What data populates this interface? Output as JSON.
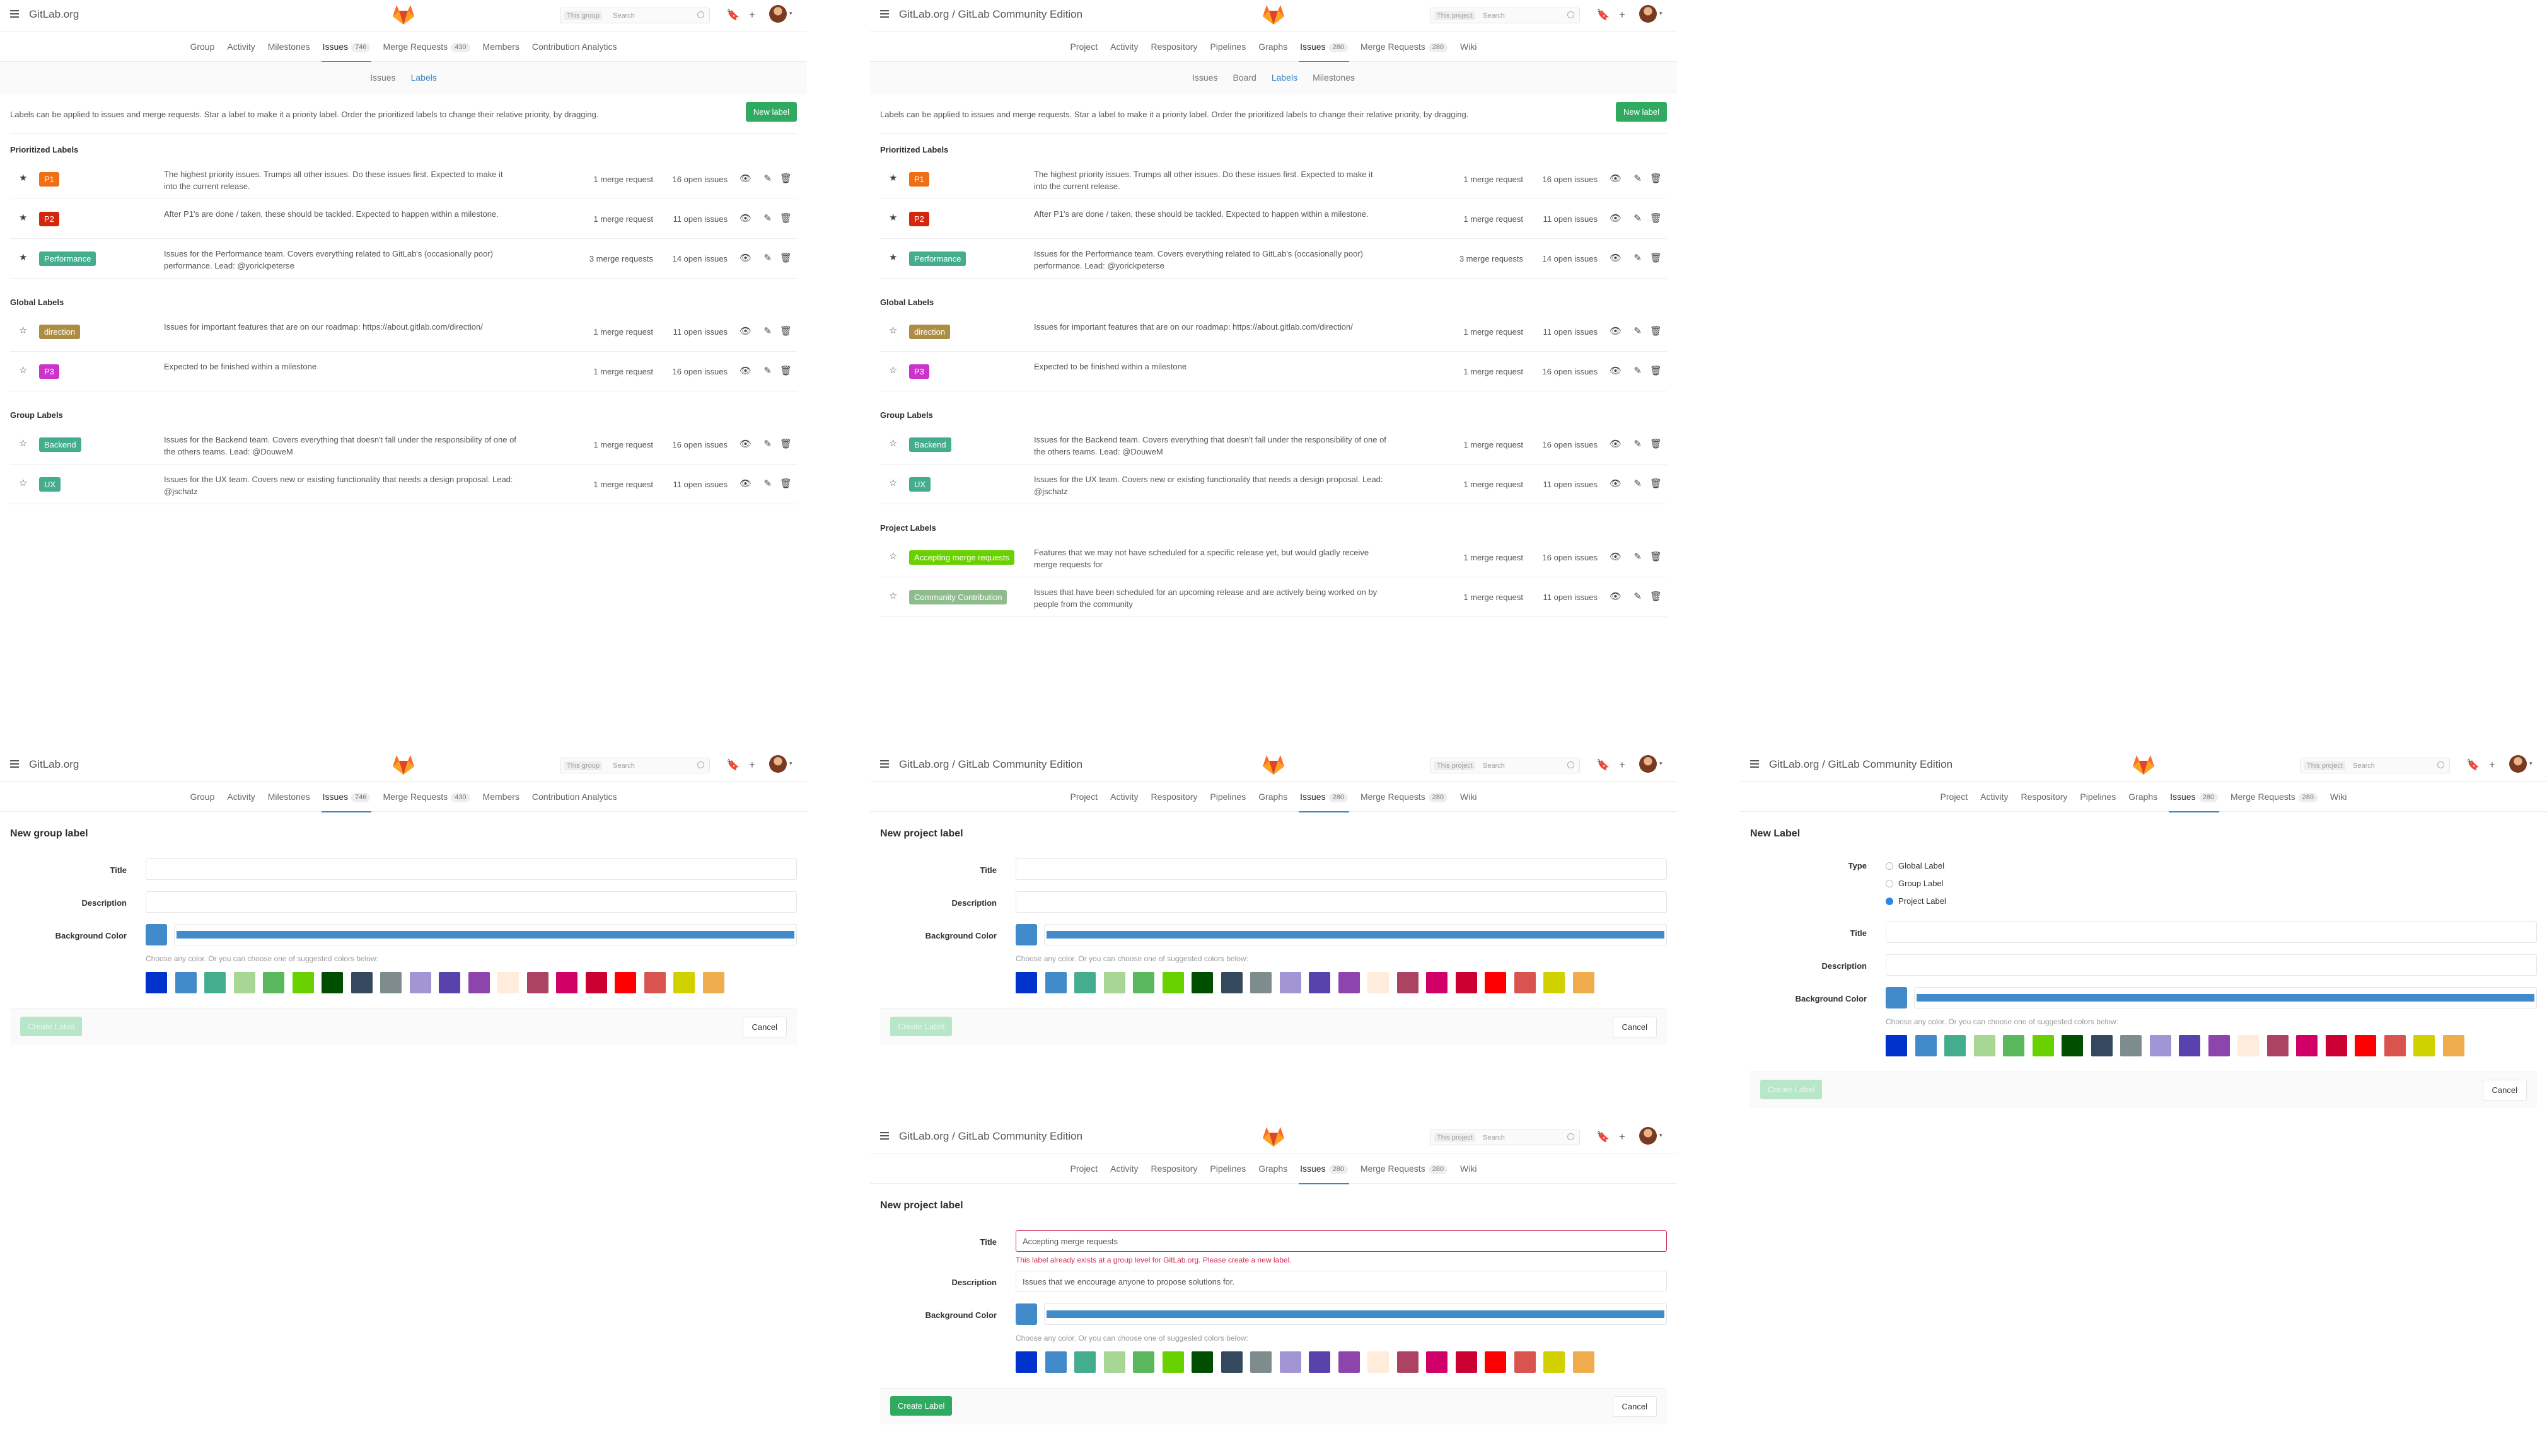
{
  "group_header": {
    "brand": "GitLab.org",
    "search_scope": "This group",
    "search_placeholder": "Search",
    "tabs": [
      {
        "label": "Group",
        "active": false
      },
      {
        "label": "Activity",
        "active": false
      },
      {
        "label": "Milestones",
        "active": false
      },
      {
        "label": "Issues",
        "count": "746",
        "active": true
      },
      {
        "label": "Merge Requests",
        "count": "430",
        "active": false
      },
      {
        "label": "Members",
        "active": false
      },
      {
        "label": "Contribution Analytics",
        "active": false
      }
    ]
  },
  "project_header": {
    "brand": "GitLab.org / GitLab Community Edition",
    "search_scope": "This project",
    "search_placeholder": "Search",
    "tabs": [
      {
        "label": "Project",
        "active": false
      },
      {
        "label": "Activity",
        "active": false
      },
      {
        "label": "Respository",
        "active": false
      },
      {
        "label": "Pipelines",
        "active": false
      },
      {
        "label": "Graphs",
        "active": false
      },
      {
        "label": "Issues",
        "count": "280",
        "active": true
      },
      {
        "label": "Merge Requests",
        "count": "280",
        "active": false
      },
      {
        "label": "Wiki",
        "active": false
      }
    ]
  },
  "group_subnav": [
    {
      "label": "Issues",
      "active": false
    },
    {
      "label": "Labels",
      "active": true
    }
  ],
  "project_subnav": [
    {
      "label": "Issues",
      "active": false
    },
    {
      "label": "Board",
      "active": false
    },
    {
      "label": "Labels",
      "active": true
    },
    {
      "label": "Milestones",
      "active": false
    }
  ],
  "labels_info": "Labels can be applied to issues and merge requests. Star a label to make it a priority label. Order the prioritized labels to change their relative priority, by dragging.",
  "new_label_button": "New label",
  "icons": {
    "star_filled": "★",
    "star_empty": "☆",
    "eye": "👁",
    "edit": "✎",
    "trash": "🗑",
    "todo": "🔖",
    "plus": "+",
    "caret": "▾"
  },
  "group_sections": [
    {
      "title": "Prioritized Labels",
      "rows": [
        {
          "starred": true,
          "name": "P1",
          "color": "#f06e14",
          "desc": "The highest priority issues. Trumps all other issues. Do these issues first. Expected to make it into the current release.",
          "mr": "1 merge request",
          "issues": "16 open issues"
        },
        {
          "starred": true,
          "name": "P2",
          "color": "#d4270e",
          "desc": "After P1's are done / taken, these should be tackled. Expected to happen within a milestone.",
          "mr": "1 merge request",
          "issues": "11 open issues"
        },
        {
          "starred": true,
          "name": "Performance",
          "color": "#44ad8e",
          "desc": "Issues for the Performance team. Covers everything related to GitLab's (occasionally poor) performance. Lead: @yorickpeterse",
          "mr": "3 merge requests",
          "issues": "14 open issues"
        }
      ]
    },
    {
      "title": "Global Labels",
      "rows": [
        {
          "starred": false,
          "name": "direction",
          "color": "#ad8d43",
          "desc": "Issues for important features that are on our roadmap: https://about.gitlab.com/direction/",
          "mr": "1 merge request",
          "issues": "11 open issues"
        },
        {
          "starred": false,
          "name": "P3",
          "color": "#cc33cc",
          "desc": "Expected to be finished within a milestone",
          "mr": "1 merge request",
          "issues": "16 open issues"
        }
      ]
    },
    {
      "title": "Group Labels",
      "rows": [
        {
          "starred": false,
          "name": "Backend",
          "color": "#44ad8e",
          "desc": "Issues for the Backend team. Covers everything that doesn't fall under the responsibility of one of the others teams. Lead: @DouweM",
          "mr": "1 merge request",
          "issues": "16 open issues"
        },
        {
          "starred": false,
          "name": "UX",
          "color": "#44ad8e",
          "desc": "Issues for the UX team. Covers new or existing functionality that needs a design proposal. Lead: @jschatz",
          "mr": "1 merge request",
          "issues": "11 open issues"
        }
      ]
    }
  ],
  "project_sections": [
    {
      "title": "Prioritized Labels",
      "rows": [
        {
          "starred": true,
          "name": "P1",
          "color": "#f06e14",
          "desc": "The highest priority issues. Trumps all other issues. Do these issues first. Expected to make it into the current release.",
          "mr": "1 merge request",
          "issues": "16 open issues"
        },
        {
          "starred": true,
          "name": "P2",
          "color": "#d4270e",
          "desc": "After P1's are done / taken, these should be tackled. Expected to happen within a milestone.",
          "mr": "1 merge request",
          "issues": "11 open issues"
        },
        {
          "starred": true,
          "name": "Performance",
          "color": "#44ad8e",
          "desc": "Issues for the Performance team. Covers everything related to GitLab's (occasionally poor) performance. Lead: @yorickpeterse",
          "mr": "3 merge requests",
          "issues": "14 open issues"
        }
      ]
    },
    {
      "title": "Global Labels",
      "rows": [
        {
          "starred": false,
          "name": "direction",
          "color": "#ad8d43",
          "desc": "Issues for important features that are on our roadmap: https://about.gitlab.com/direction/",
          "mr": "1 merge request",
          "issues": "11 open issues"
        },
        {
          "starred": false,
          "name": "P3",
          "color": "#cc33cc",
          "desc": "Expected to be finished within a milestone",
          "mr": "1 merge request",
          "issues": "16 open issues"
        }
      ]
    },
    {
      "title": "Group Labels",
      "rows": [
        {
          "starred": false,
          "name": "Backend",
          "color": "#44ad8e",
          "desc": "Issues for the Backend team. Covers everything that doesn't fall under the responsibility of one of the others teams. Lead: @DouweM",
          "mr": "1 merge request",
          "issues": "16 open issues"
        },
        {
          "starred": false,
          "name": "UX",
          "color": "#44ad8e",
          "desc": "Issues for the UX team. Covers new or existing functionality that needs a design proposal. Lead: @jschatz",
          "mr": "1 merge request",
          "issues": "11 open issues"
        }
      ]
    },
    {
      "title": "Project Labels",
      "rows": [
        {
          "starred": false,
          "name": "Accepting merge requests",
          "color": "#69d100",
          "desc": "Features that we may not have scheduled for a specific release yet, but would gladly receive merge requests for",
          "mr": "1 merge request",
          "issues": "16 open issues"
        },
        {
          "starred": false,
          "name": "Community Contribution",
          "color": "#8fbc8f",
          "desc": "Issues that have been scheduled for an upcoming release and are actively being worked on by people from the community",
          "mr": "1 merge request",
          "issues": "11 open issues"
        }
      ]
    }
  ],
  "form": {
    "group_title": "New group label",
    "project_title": "New project label",
    "generic_title": "New Label",
    "title_label": "Title",
    "description_label": "Description",
    "color_label": "Background Color",
    "type_label": "Type",
    "types": [
      "Global Label",
      "Group Label",
      "Project Label"
    ],
    "selected_type": "Project Label",
    "hint": "Choose any color. Or you can choose one of suggested colors below:",
    "create": "Create Label",
    "cancel": "Cancel",
    "color": "#428bca",
    "filled_title": "Accepting merge requests",
    "filled_description": "Issues that we encourage anyone to propose solutions for.",
    "error": "This label already exists at a group level for GitLab.org. Please create a new label."
  },
  "swatches": [
    "#0033cc",
    "#428bca",
    "#44ad8e",
    "#a8d695",
    "#5cb85c",
    "#69d100",
    "#004e00",
    "#34495e",
    "#7f8c8d",
    "#a295d6",
    "#5843ad",
    "#8e44ad",
    "#ffecdb",
    "#ad4363",
    "#d10069",
    "#cc0033",
    "#ff0000",
    "#d9534f",
    "#d1d100",
    "#f0ad4e"
  ]
}
